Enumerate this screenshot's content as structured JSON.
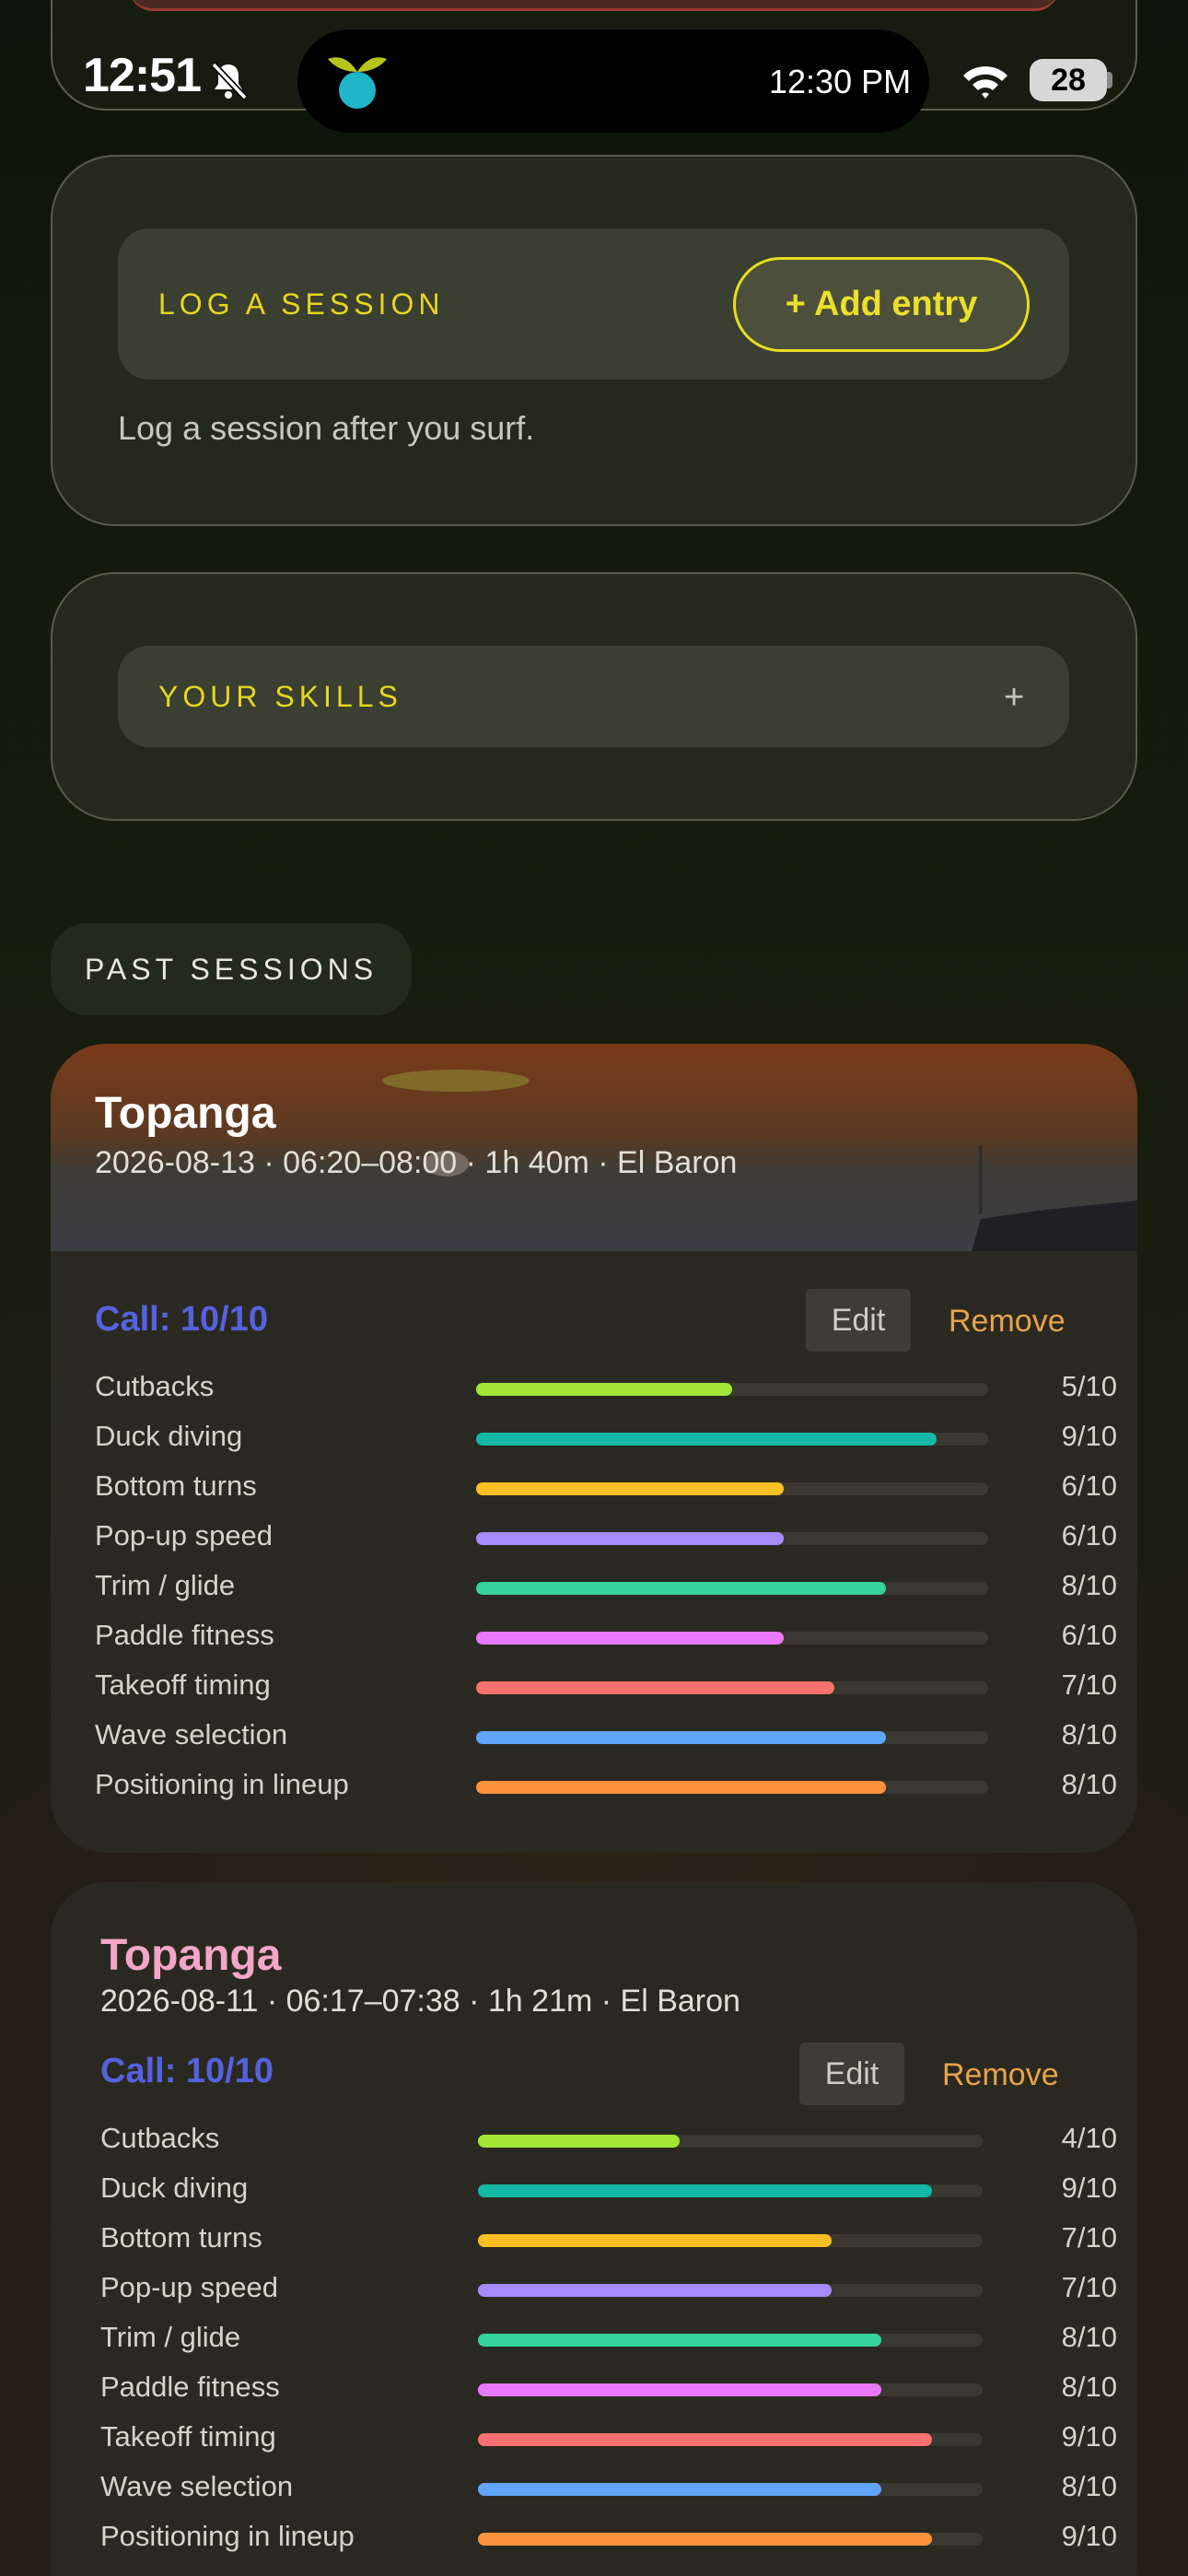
{
  "status_bar": {
    "time": "12:51",
    "island_time": "12:30 PM",
    "battery": "28"
  },
  "log_card": {
    "label": "LOG A SESSION",
    "add_button": "+ Add entry",
    "hint": "Log a session after you surf."
  },
  "skills_card": {
    "label": "YOUR SKILLS",
    "expand": "+"
  },
  "past_sessions_label": "PAST SESSIONS",
  "colors": {
    "accent_yellow": "#e6d61f",
    "call_blue": "#5462e0",
    "remove_orange": "#e8a34c",
    "second_title_pink": "#f4a6c8"
  },
  "sessions": [
    {
      "title": "Topanga",
      "meta": "2026-08-13 · 06:20–08:00 · 1h 40m · El Baron",
      "call": "Call: 10/10",
      "edit": "Edit",
      "remove": "Remove",
      "skills": [
        {
          "name": "Cutbacks",
          "score": "5/10",
          "value": 5,
          "color": "#a3e635"
        },
        {
          "name": "Duck diving",
          "score": "9/10",
          "value": 9,
          "color": "#14b8a6"
        },
        {
          "name": "Bottom turns",
          "score": "6/10",
          "value": 6,
          "color": "#fbbf24"
        },
        {
          "name": "Pop-up speed",
          "score": "6/10",
          "value": 6,
          "color": "#a78bfa"
        },
        {
          "name": "Trim / glide",
          "score": "8/10",
          "value": 8,
          "color": "#34d399"
        },
        {
          "name": "Paddle fitness",
          "score": "6/10",
          "value": 6,
          "color": "#e879f9"
        },
        {
          "name": "Takeoff timing",
          "score": "7/10",
          "value": 7,
          "color": "#f87171"
        },
        {
          "name": "Wave selection",
          "score": "8/10",
          "value": 8,
          "color": "#60a5fa"
        },
        {
          "name": "Positioning in lineup",
          "score": "8/10",
          "value": 8,
          "color": "#fb923c"
        }
      ]
    },
    {
      "title": "Topanga",
      "meta": "2026-08-11 · 06:17–07:38 · 1h 21m · El Baron",
      "call": "Call: 10/10",
      "edit": "Edit",
      "remove": "Remove",
      "skills": [
        {
          "name": "Cutbacks",
          "score": "4/10",
          "value": 4,
          "color": "#a3e635"
        },
        {
          "name": "Duck diving",
          "score": "9/10",
          "value": 9,
          "color": "#14b8a6"
        },
        {
          "name": "Bottom turns",
          "score": "7/10",
          "value": 7,
          "color": "#fbbf24"
        },
        {
          "name": "Pop-up speed",
          "score": "7/10",
          "value": 7,
          "color": "#a78bfa"
        },
        {
          "name": "Trim / glide",
          "score": "8/10",
          "value": 8,
          "color": "#34d399"
        },
        {
          "name": "Paddle fitness",
          "score": "8/10",
          "value": 8,
          "color": "#e879f9"
        },
        {
          "name": "Takeoff timing",
          "score": "9/10",
          "value": 9,
          "color": "#f87171"
        },
        {
          "name": "Wave selection",
          "score": "8/10",
          "value": 8,
          "color": "#60a5fa"
        },
        {
          "name": "Positioning in lineup",
          "score": "9/10",
          "value": 9,
          "color": "#fb923c"
        }
      ]
    }
  ]
}
